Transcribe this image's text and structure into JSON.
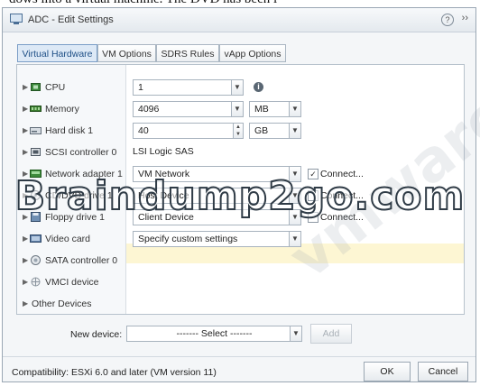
{
  "page_top_text": "dows into a virtual machine. The DVD has been i",
  "dialog": {
    "title": "ADC - Edit Settings",
    "help_symbol": "?",
    "expand_symbol": "››"
  },
  "tabs": [
    {
      "label": "Virtual Hardware",
      "active": true
    },
    {
      "label": "VM Options",
      "active": false
    },
    {
      "label": "SDRS Rules",
      "active": false
    },
    {
      "label": "vApp Options",
      "active": false
    }
  ],
  "hardware": {
    "cpu": {
      "label": "CPU",
      "value": "1"
    },
    "memory": {
      "label": "Memory",
      "value": "4096",
      "unit": "MB"
    },
    "hard_disk": {
      "label": "Hard disk 1",
      "value": "40",
      "unit": "GB"
    },
    "scsi": {
      "label": "SCSI controller 0",
      "value": "LSI Logic SAS"
    },
    "network": {
      "label": "Network adapter 1",
      "value": "VM Network",
      "connect": "Connect..."
    },
    "cd_dvd": {
      "label": "CD/DVD drive 1",
      "value": "Host Device",
      "connect": "Connect..."
    },
    "floppy": {
      "label": "Floppy drive 1",
      "value": "Client Device",
      "connect": "Connect..."
    },
    "video": {
      "label": "Video card",
      "value": "Specify custom settings"
    },
    "sata": {
      "label": "SATA controller 0"
    },
    "vmci": {
      "label": "VMCI device"
    },
    "other": {
      "label": "Other Devices"
    }
  },
  "new_device": {
    "label": "New device:",
    "placeholder": "------- Select -------",
    "add_label": "Add"
  },
  "footer": {
    "compatibility": "Compatibility: ESXi 6.0 and later (VM version 11)",
    "ok_label": "OK",
    "cancel_label": "Cancel"
  },
  "watermarks": {
    "braindump": "Braindump2go.com",
    "vmware": "vmware"
  }
}
